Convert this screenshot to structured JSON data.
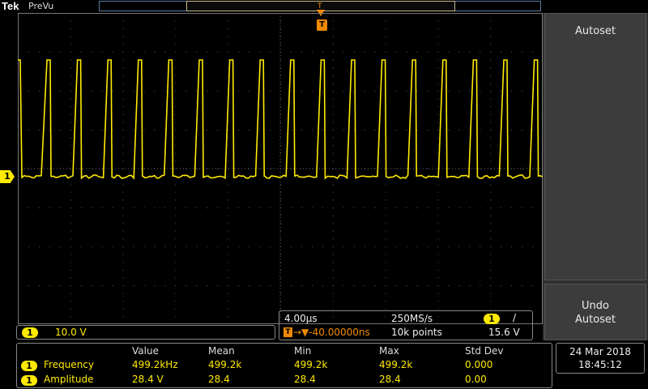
{
  "header": {
    "brand": "Tek",
    "mode": "PreVu"
  },
  "trigger": {
    "marker_label": "T",
    "level_label": "T"
  },
  "channel": {
    "marker_label": "1",
    "color": "#ffea00"
  },
  "side_menu": {
    "autoset_label": "Autoset",
    "undo_line1": "Undo",
    "undo_line2": "Autoset"
  },
  "ch1_scale": {
    "channel": "1",
    "value": "10.0 V"
  },
  "timebase": {
    "time_per_div": "4.00µs",
    "sample_rate": "250MS/s",
    "trigger_channel": "1",
    "trigger_slope": "/",
    "trigger_position": "→▼-40.00000ns",
    "record_length": "10k points",
    "trigger_level": "15.6 V"
  },
  "measurements": {
    "headers": [
      "Value",
      "Mean",
      "Min",
      "Max",
      "Std Dev"
    ],
    "rows": [
      {
        "channel": "1",
        "name": "Frequency",
        "value": "499.2kHz",
        "mean": "499.2k",
        "min": "499.2k",
        "max": "499.2k",
        "std_dev": "0.000"
      },
      {
        "channel": "1",
        "name": "Amplitude",
        "value": "28.4 V",
        "mean": "28.4",
        "min": "28.4",
        "max": "28.4",
        "std_dev": "0.00"
      }
    ]
  },
  "datetime": {
    "date": "24 Mar  2018",
    "time": "18:45:12"
  },
  "colors": {
    "trace": "#ffea00",
    "trigger": "#f08a00",
    "grid": "#555555",
    "menu": "#3c3c3c"
  }
}
